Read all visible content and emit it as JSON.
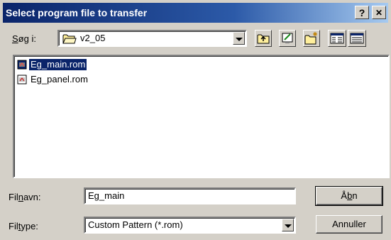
{
  "window": {
    "title": "Select program file to transfer",
    "help_button": "?",
    "close_button": "✕"
  },
  "look_in": {
    "label": "Søg i:",
    "label_accel": "S",
    "label_rest": "øg i:",
    "value": "v2_05",
    "value_icon": "folder-icon"
  },
  "toolbar": {
    "buttons": [
      "up-folder",
      "desktop",
      "new-folder",
      "list-view",
      "details-view"
    ]
  },
  "files": [
    {
      "name": "Eg_main.rom",
      "icon": "rom-file-icon",
      "selected": true
    },
    {
      "name": "Eg_panel.rom",
      "icon": "rom-file-icon",
      "selected": false
    }
  ],
  "filename": {
    "label_pre": "Fil",
    "label_accel": "n",
    "label_post": "avn:",
    "value": "Eg_main"
  },
  "filetype": {
    "label_pre": "Fil",
    "label_accel": "t",
    "label_post": "ype:",
    "value": "Custom Pattern (*.rom)"
  },
  "buttons": {
    "open_pre": "Å",
    "open_accel": "b",
    "open_post": "n",
    "cancel": "Annuller"
  },
  "colors": {
    "titlebar_start": "#0a246a",
    "titlebar_end": "#a6caf0",
    "face": "#d4d0c8",
    "selection": "#0a246a"
  }
}
